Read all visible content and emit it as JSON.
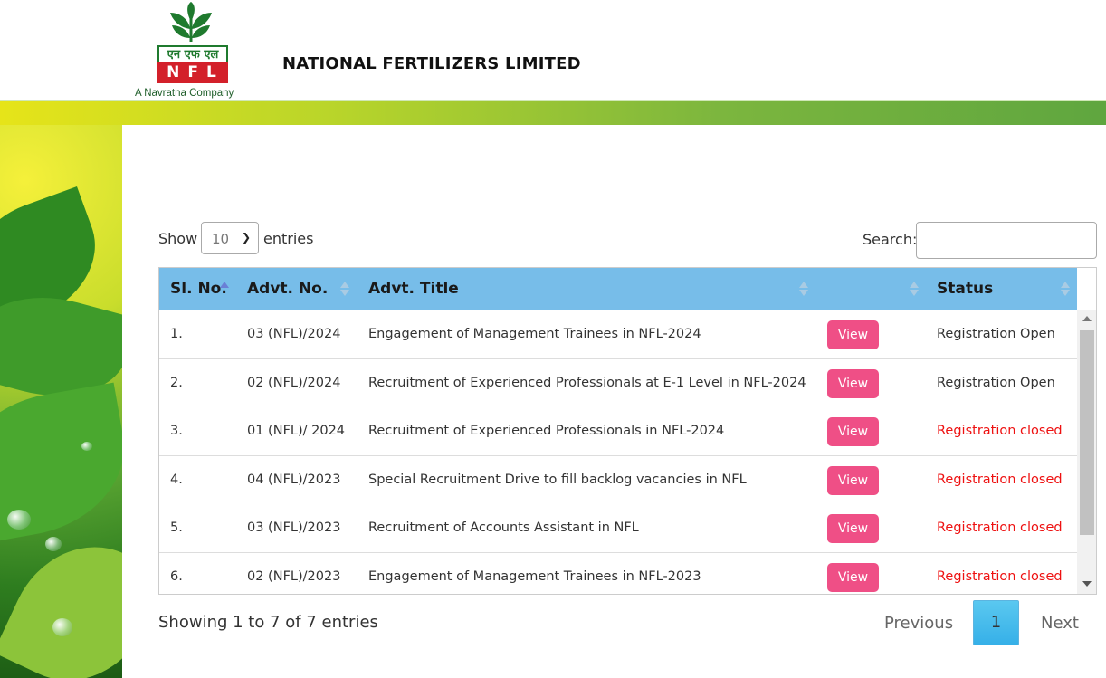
{
  "header": {
    "logo_hindi": "एन एफ एल",
    "logo_text": "NFL",
    "logo_tagline": "A Navratna Company",
    "site_title": "NATIONAL FERTILIZERS LIMITED"
  },
  "controls": {
    "show_label": "Show",
    "page_size": "10",
    "entries_label": "entries",
    "search_label": "Search:",
    "search_value": ""
  },
  "table": {
    "columns": [
      {
        "label": "Sl. No."
      },
      {
        "label": "Advt. No."
      },
      {
        "label": "Advt. Title"
      },
      {
        "label": ""
      },
      {
        "label": "Status"
      }
    ],
    "rows": [
      {
        "sl": "1.",
        "advt_no": "03 (NFL)/2024",
        "title": "Engagement of Management Trainees in NFL-2024",
        "action": "View",
        "status": "Registration Open",
        "status_type": "open"
      },
      {
        "sl": "2.",
        "advt_no": "02 (NFL)/2024",
        "title": "Recruitment of Experienced Professionals at E-1 Level in NFL-2024",
        "action": "View",
        "status": "Registration Open",
        "status_type": "open"
      },
      {
        "sl": "3.",
        "advt_no": "01 (NFL)/ 2024",
        "title": "Recruitment of Experienced Professionals in NFL-2024",
        "action": "View",
        "status": "Registration closed",
        "status_type": "closed"
      },
      {
        "sl": "4.",
        "advt_no": "04 (NFL)/2023",
        "title": "Special Recruitment Drive to fill backlog vacancies in NFL",
        "action": "View",
        "status": "Registration closed",
        "status_type": "closed"
      },
      {
        "sl": "5.",
        "advt_no": "03 (NFL)/2023",
        "title": "Recruitment of Accounts Assistant in NFL",
        "action": "View",
        "status": "Registration closed",
        "status_type": "closed"
      },
      {
        "sl": "6.",
        "advt_no": "02 (NFL)/2023",
        "title": "Engagement of Management Trainees in NFL-2023",
        "action": "View",
        "status": "Registration closed",
        "status_type": "closed"
      }
    ]
  },
  "footer": {
    "showing": "Showing 1 to 7 of 7 entries",
    "previous": "Previous",
    "current_page": "1",
    "next": "Next"
  },
  "colors": {
    "header_row": "#77bde9",
    "view_button": "#ef4f86",
    "status_closed": "#e11111",
    "active_page": "#36b0e8"
  }
}
